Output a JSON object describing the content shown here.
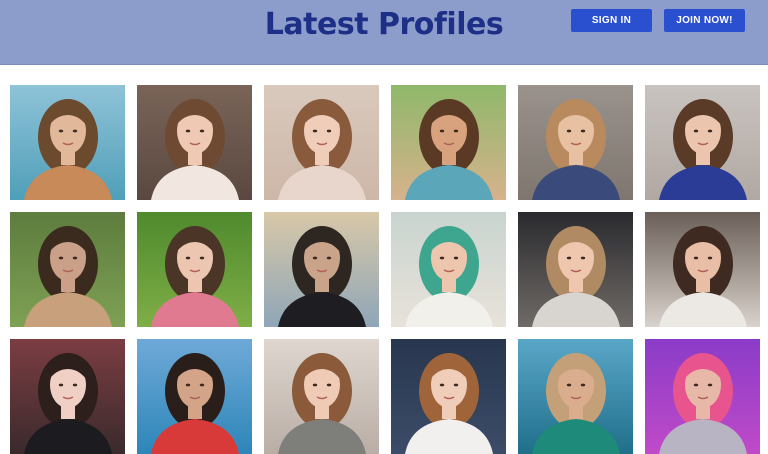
{
  "header": {
    "title": "Latest Profiles",
    "sign_in_label": "SIGN IN",
    "join_label": "JOIN NOW!",
    "background_color": "#8c9ccb",
    "title_color": "#1d2f86",
    "button_color": "#2b50cf"
  },
  "profiles": [
    {
      "bg": "#8fc3d8",
      "mid": "#4f9fb8",
      "hair": "#6b4a2e",
      "skin": "#e2b89a",
      "top": "#c98a5a"
    },
    {
      "bg": "#7a6458",
      "mid": "#5a4840",
      "hair": "#6e4a32",
      "skin": "#efc9b4",
      "top": "#f2e6e0"
    },
    {
      "bg": "#d9c9bd",
      "mid": "#cdb7a8",
      "hair": "#8a5a3c",
      "skin": "#f0cdb9",
      "top": "#e8d6cc"
    },
    {
      "bg": "#8fb86a",
      "mid": "#d7b28d",
      "hair": "#5a3a24",
      "skin": "#d9a27e",
      "top": "#5ba6b8"
    },
    {
      "bg": "#9a938d",
      "mid": "#7e766f",
      "hair": "#b98a5e",
      "skin": "#e8c0a2",
      "top": "#3a4a7a"
    },
    {
      "bg": "#c9c3bf",
      "mid": "#b0a8a3",
      "hair": "#5a3b28",
      "skin": "#ecc5ae",
      "top": "#2a3c96"
    },
    {
      "bg": "#5d7c3e",
      "mid": "#7ea154",
      "hair": "#3b2a1e",
      "skin": "#caa088",
      "top": "#c9a07c"
    },
    {
      "bg": "#4f8a2e",
      "mid": "#7fae46",
      "hair": "#4a3526",
      "skin": "#ecc6b0",
      "top": "#e07a90"
    },
    {
      "bg": "#d8c8a8",
      "mid": "#8fa6b8",
      "hair": "#2e2620",
      "skin": "#c9a48a",
      "top": "#1e1e22"
    },
    {
      "bg": "#c9d4cf",
      "mid": "#e8e2da",
      "hair": "#3ea58e",
      "skin": "#edc6ad",
      "top": "#f2f0ea"
    },
    {
      "bg": "#2a2a2e",
      "mid": "#6f6a66",
      "hair": "#b08a62",
      "skin": "#efc6ae",
      "top": "#d8d4d0"
    },
    {
      "bg": "#6a5e58",
      "mid": "#d9d2cc",
      "hair": "#3e2a20",
      "skin": "#e8bfa6",
      "top": "#ece8e4"
    },
    {
      "bg": "#7b3d42",
      "mid": "#3a2a2c",
      "hair": "#2c1f1c",
      "skin": "#f0d0c4",
      "top": "#1c1c20"
    },
    {
      "bg": "#6fa9d8",
      "mid": "#2d86b8",
      "hair": "#2a1e1a",
      "skin": "#d4a488",
      "top": "#d83a3a"
    },
    {
      "bg": "#ded6cf",
      "mid": "#b9aea6",
      "hair": "#8a5a3a",
      "skin": "#efcab4",
      "top": "#7e7e7a"
    },
    {
      "bg": "#28364e",
      "mid": "#3c4c68",
      "hair": "#a0643a",
      "skin": "#f0cdb8",
      "top": "#f2f0ee"
    },
    {
      "bg": "#5aa6c8",
      "mid": "#1f6f8a",
      "hair": "#c4a078",
      "skin": "#d9ad8e",
      "top": "#1e8a7a"
    },
    {
      "bg": "#8a3cc8",
      "mid": "#c04ac8",
      "hair": "#e8548e",
      "skin": "#e7b8a8",
      "top": "#b8b4c4"
    }
  ]
}
